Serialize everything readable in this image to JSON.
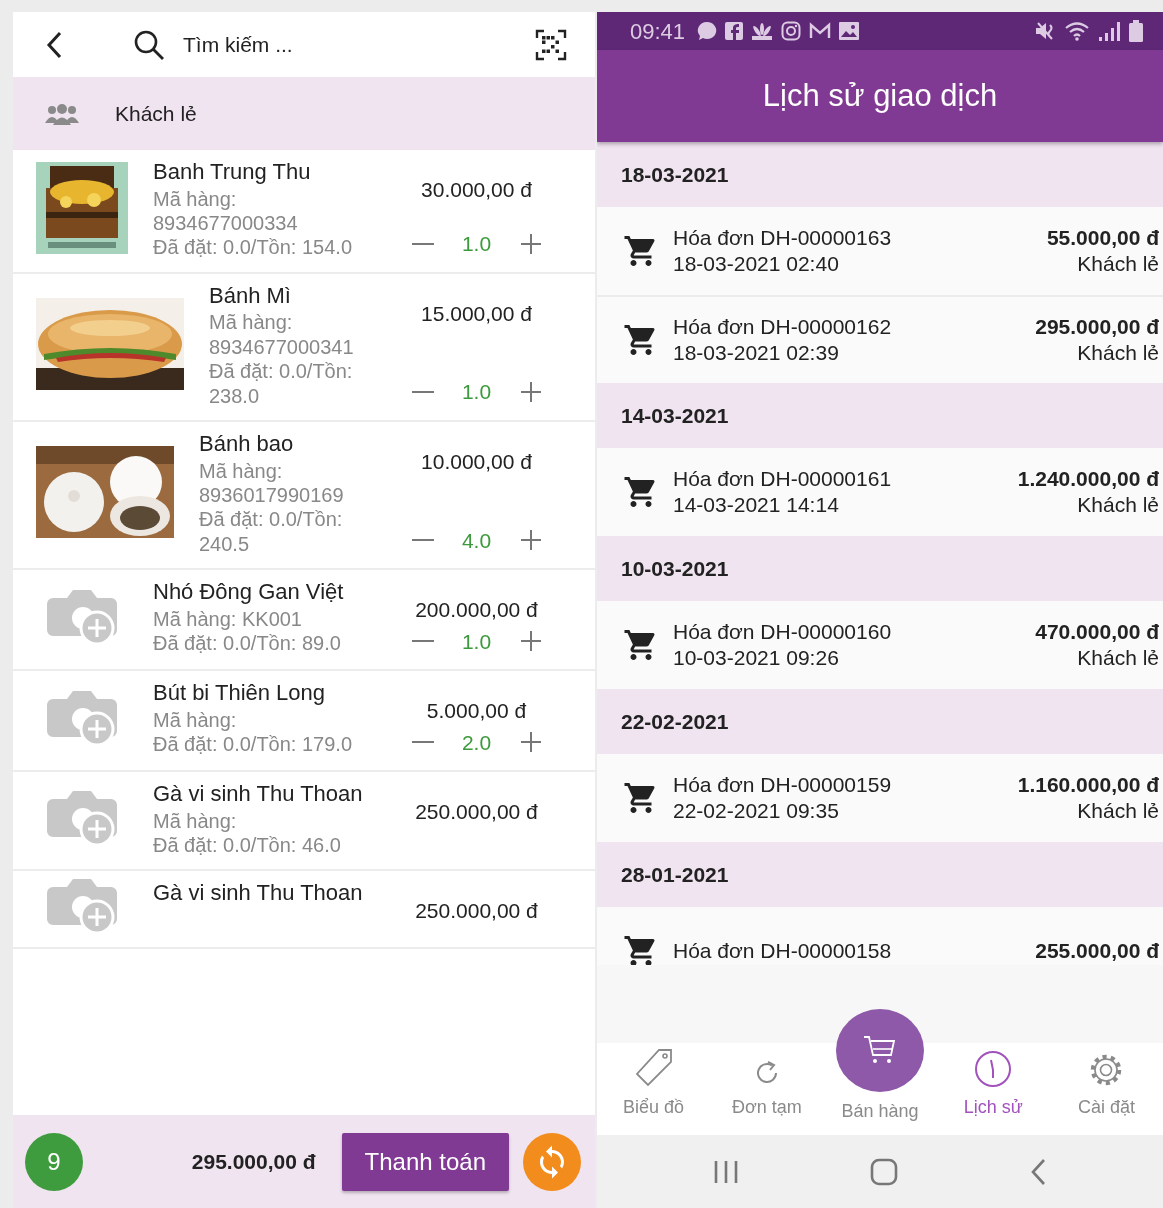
{
  "search_bar": {
    "placeholder": "Tìm kiếm ..."
  },
  "customer": {
    "name": "Khách lẻ"
  },
  "products": [
    {
      "name": "Banh Trung Thu",
      "code": "Mã hàng: 8934677000334",
      "stock": "Đã đặt: 0.0/Tồn: 154.0",
      "price": "30.000,00 đ",
      "quantity": "1.0"
    },
    {
      "name": "Bánh Mì",
      "code": "Mã hàng: 8934677000341",
      "stock": "Đã đặt: 0.0/Tồn: 238.0",
      "price": "15.000,00 đ",
      "quantity": "1.0"
    },
    {
      "name": "Bánh bao",
      "code": "Mã hàng: 8936017990169",
      "stock": "Đã đặt: 0.0/Tồn: 240.5",
      "price": "10.000,00 đ",
      "quantity": "4.0"
    },
    {
      "image": {
        "kind": "placeholder"
      },
      "name": "Nhó Đông Gan Việt",
      "code": "Mã hàng: KK001",
      "stock": "Đã đặt: 0.0/Tồn: 89.0",
      "price": "200.000,00 đ",
      "quantity": "1.0"
    },
    {
      "image": {
        "kind": "placeholder"
      },
      "name": "Bút bi Thiên Long",
      "code": "Mã hàng:",
      "stock": "Đã đặt: 0.0/Tồn: 179.0",
      "price": "5.000,00 đ",
      "quantity": "2.0"
    },
    {
      "image": {
        "kind": "placeholder"
      },
      "name": "Gà vi sinh Thu Thoan",
      "code": "Mã hàng:",
      "stock": "Đã đặt: 0.0/Tồn: 46.0",
      "price": "250.000,00 đ"
    },
    {
      "image": {
        "kind": "placeholder"
      },
      "name": "Gà vi sinh Thu Thoan",
      "price": "250.000,00 đ"
    }
  ],
  "cart_footer": {
    "count": "9",
    "total": "295.000,00 đ",
    "pay_button": "Thanh toán"
  },
  "status_bar": {
    "time": "09:41"
  },
  "history": {
    "title": "Lịch sử giao dịch",
    "groups": [
      {
        "date": "18-03-2021",
        "transactions": [
          {
            "invoice": "Hóa đơn DH-00000163",
            "datetime": "18-03-2021 02:40",
            "amount": "55.000,00 đ",
            "customer": "Khách lẻ"
          },
          {
            "invoice": "Hóa đơn DH-00000162",
            "datetime": "18-03-2021 02:39",
            "amount": "295.000,00 đ",
            "customer": "Khách lẻ"
          }
        ]
      },
      {
        "date": "14-03-2021",
        "transactions": [
          {
            "invoice": "Hóa đơn DH-00000161",
            "datetime": "14-03-2021 14:14",
            "amount": "1.240.000,00 đ",
            "customer": "Khách lẻ"
          }
        ]
      },
      {
        "date": "10-03-2021",
        "transactions": [
          {
            "invoice": "Hóa đơn DH-00000160",
            "datetime": "10-03-2021 09:26",
            "amount": "470.000,00 đ",
            "customer": "Khách lẻ"
          }
        ]
      },
      {
        "date": "22-02-2021",
        "transactions": [
          {
            "invoice": "Hóa đơn DH-00000159",
            "datetime": "22-02-2021 09:35",
            "amount": "1.160.000,00 đ",
            "customer": "Khách lẻ"
          }
        ]
      },
      {
        "date": "28-01-2021",
        "transactions": [
          {
            "invoice": "Hóa đơn DH-00000158",
            "amount": "255.000,00 đ"
          }
        ]
      }
    ]
  },
  "bottom_nav": [
    {
      "label": "Biểu đồ",
      "kind": "tab",
      "selected": false
    },
    {
      "label": "Đơn tạm",
      "kind": "tab",
      "selected": false
    },
    {
      "label": "Bán hàng",
      "kind": "raised",
      "selected": false
    },
    {
      "label": "Lịch sử",
      "kind": "tab",
      "selected": true
    },
    {
      "label": "Cài đặt",
      "kind": "tab",
      "selected": false
    }
  ]
}
